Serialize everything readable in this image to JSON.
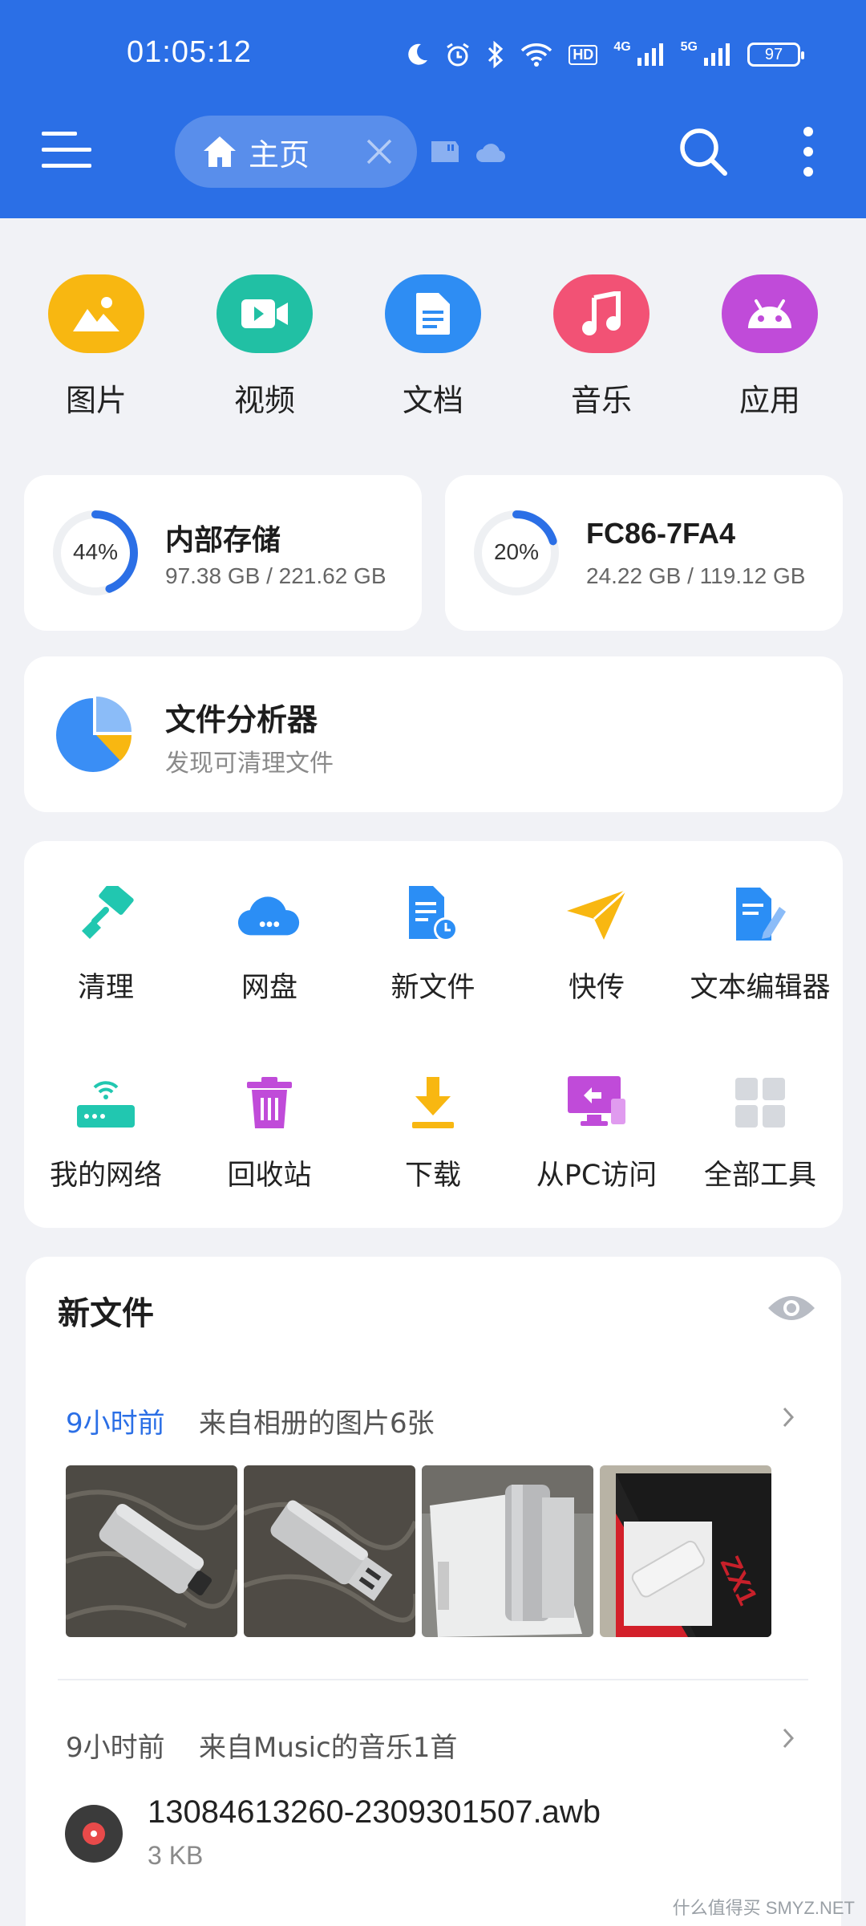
{
  "status_bar": {
    "time": "01:05:12",
    "hd_label": "HD",
    "signal_1": "4G",
    "signal_2": "5G",
    "battery": "97"
  },
  "header": {
    "home_tab_label": "主页",
    "icons": [
      "menu-icon",
      "home-icon",
      "close-icon",
      "sd-card-icon",
      "cloud-icon",
      "search-icon",
      "more-vertical-icon"
    ]
  },
  "categories": [
    {
      "label": "图片",
      "icon": "image-icon",
      "color": "#f8b711"
    },
    {
      "label": "视频",
      "icon": "video-icon",
      "color": "#21c0a4"
    },
    {
      "label": "文档",
      "icon": "document-icon",
      "color": "#2e8df3"
    },
    {
      "label": "音乐",
      "icon": "music-icon",
      "color": "#f25275"
    },
    {
      "label": "应用",
      "icon": "android-icon",
      "color": "#c04bd9"
    }
  ],
  "storage": {
    "internal": {
      "name": "内部存储",
      "usage": "97.38 GB / 221.62 GB",
      "percent_label": "44%",
      "percent": 0.44
    },
    "external": {
      "name": "FC86-7FA4",
      "usage": "24.22 GB / 119.12 GB",
      "percent_label": "20%",
      "percent": 0.2
    }
  },
  "analyzer": {
    "title": "文件分析器",
    "subtitle": "发现可清理文件"
  },
  "tools": [
    {
      "label": "清理",
      "icon": "broom-icon"
    },
    {
      "label": "网盘",
      "icon": "cloud-drive-icon"
    },
    {
      "label": "新文件",
      "icon": "new-file-icon"
    },
    {
      "label": "快传",
      "icon": "paper-plane-icon"
    },
    {
      "label": "文本编辑器",
      "icon": "text-editor-icon"
    },
    {
      "label": "我的网络",
      "icon": "router-icon"
    },
    {
      "label": "回收站",
      "icon": "trash-icon"
    },
    {
      "label": "下载",
      "icon": "download-icon"
    },
    {
      "label": "从PC访问",
      "icon": "pc-access-icon"
    },
    {
      "label": "全部工具",
      "icon": "all-tools-icon"
    }
  ],
  "recent": {
    "title": "新文件",
    "groups": [
      {
        "time": "9小时前",
        "desc": "来自相册的图片6张"
      },
      {
        "time": "9小时前",
        "desc": "来自Music的音乐1首"
      }
    ],
    "file": {
      "name": "13084613260-2309301507.awb",
      "size": "3 KB"
    }
  },
  "watermark": "什么值得买 SMYZ.NET",
  "colors": {
    "header_blue": "#2b6fe6",
    "accent_blue": "#2b6fe6",
    "background": "#f1f2f6"
  }
}
